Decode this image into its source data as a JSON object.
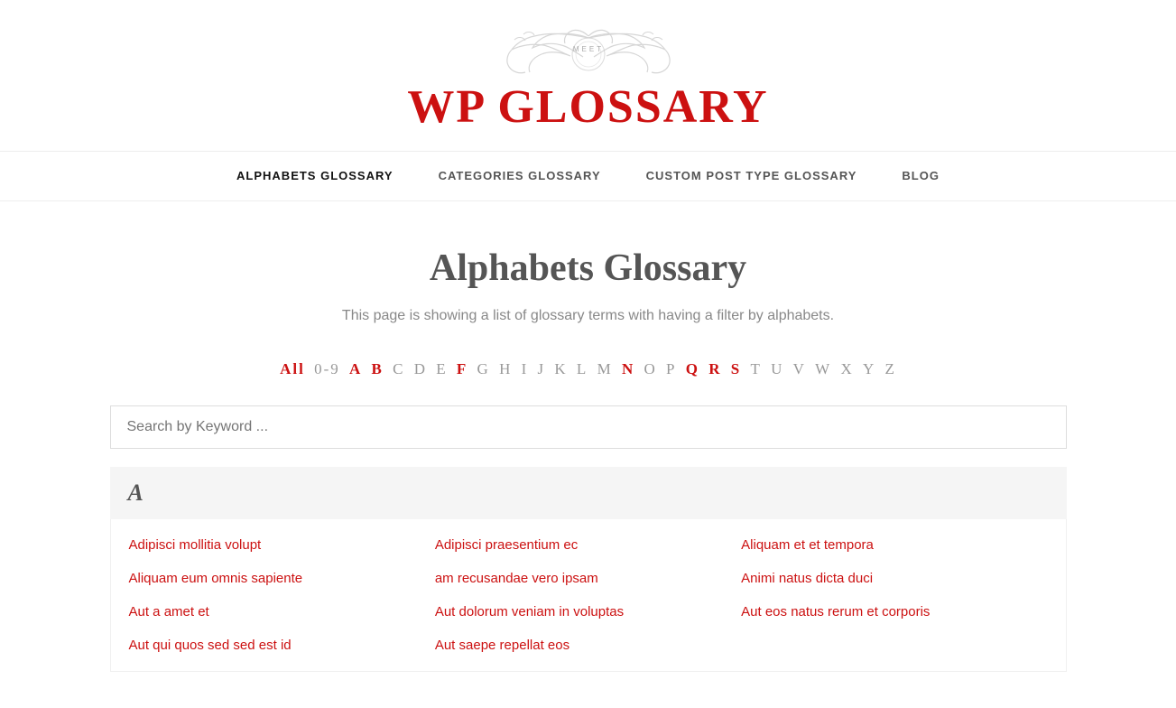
{
  "header": {
    "meet_label": "MEET",
    "logo_text": "WP GLOSSARY"
  },
  "nav": {
    "items": [
      {
        "label": "ALPHABETS GLOSSARY",
        "active": true,
        "href": "#"
      },
      {
        "label": "CATEGORIES GLOSSARY",
        "active": false,
        "href": "#"
      },
      {
        "label": "CUSTOM POST TYPE GLOSSARY",
        "active": false,
        "href": "#"
      },
      {
        "label": "BLOG",
        "active": false,
        "href": "#"
      }
    ]
  },
  "main": {
    "page_title": "Alphabets Glossary",
    "page_description": "This page is showing a list of glossary terms with having a filter by alphabets.",
    "alphabet_filter": {
      "active": "All",
      "items": [
        "All",
        "0-9",
        "A",
        "B",
        "C",
        "D",
        "E",
        "F",
        "G",
        "H",
        "I",
        "J",
        "K",
        "L",
        "M",
        "N",
        "O",
        "P",
        "Q",
        "R",
        "S",
        "T",
        "U",
        "V",
        "W",
        "X",
        "Y",
        "Z"
      ],
      "bold_letters": [
        "A",
        "B",
        "F",
        "N",
        "Q",
        "R",
        "S"
      ]
    },
    "search_placeholder": "Search by Keyword ...",
    "sections": [
      {
        "letter": "A",
        "terms": [
          "Adipisci mollitia volupt",
          "Adipisci praesentium ec",
          "Aliquam et et tempora",
          "Aliquam eum omnis sapiente",
          "am recusandae vero ipsam",
          "Animi natus dicta duci",
          "Aut a amet et",
          "Aut dolorum veniam in voluptas",
          "Aut eos natus rerum et corporis",
          "Aut qui quos sed sed est id",
          "Aut saepe repellat eos"
        ]
      }
    ]
  }
}
